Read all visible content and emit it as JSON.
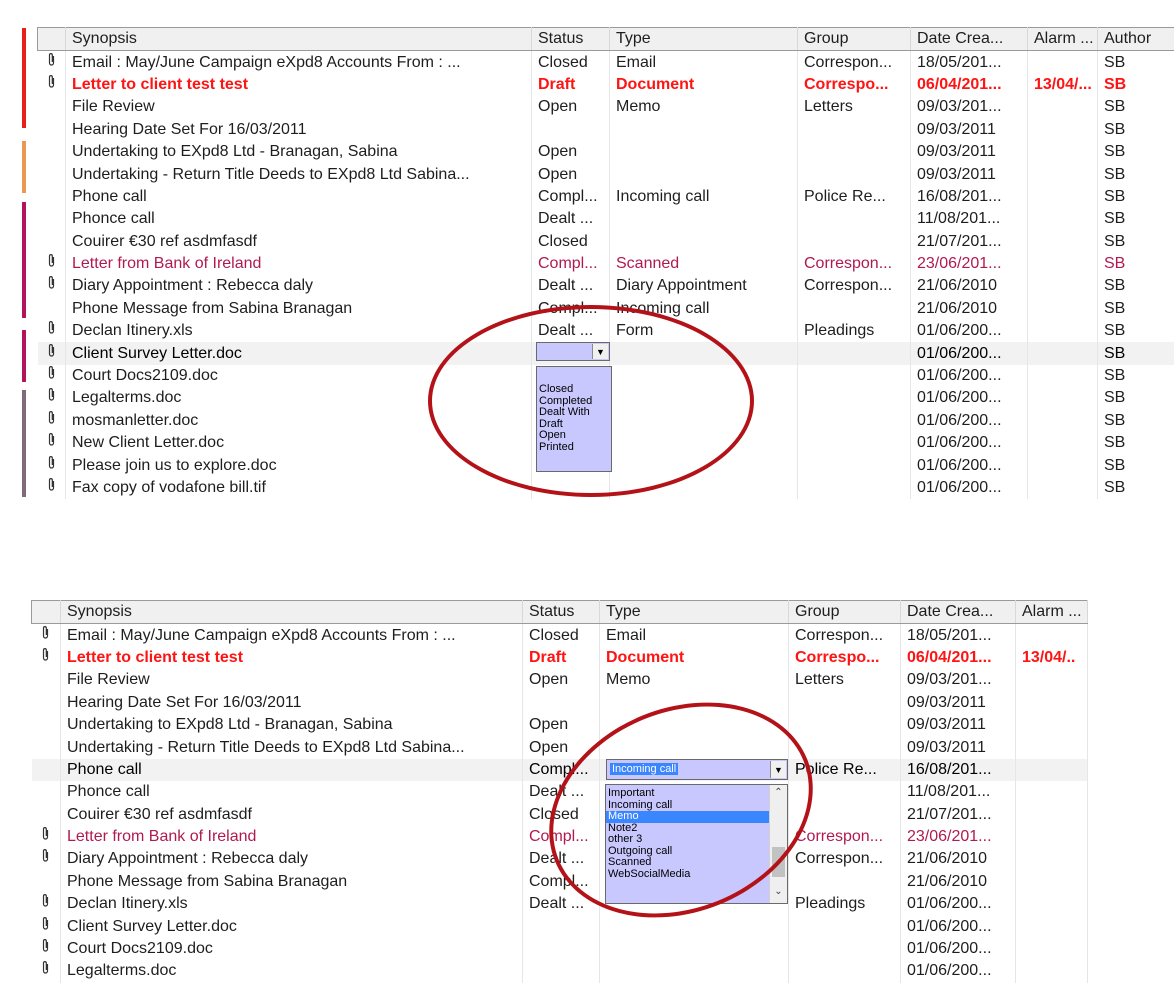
{
  "top_panel": {
    "columns": [
      "",
      "Synopsis",
      "Status",
      "Type",
      "Group",
      "Date Crea...",
      "Alarm ...",
      "Author"
    ],
    "rows": [
      {
        "clip": true,
        "style": "",
        "cells": [
          "Email : May/June Campaign eXpd8 Accounts From : ...",
          "Closed",
          "Email",
          "Correspon...",
          "18/05/201...",
          "",
          "SB"
        ]
      },
      {
        "clip": true,
        "style": "bold",
        "cells": [
          "Letter to client test test",
          "Draft",
          "Document",
          "Correspo...",
          "06/04/201...",
          "13/04/...",
          "SB"
        ]
      },
      {
        "clip": false,
        "style": "",
        "cells": [
          "File Review",
          "Open",
          "Memo",
          "Letters",
          "09/03/201...",
          "",
          "SB"
        ]
      },
      {
        "clip": false,
        "style": "",
        "cells": [
          "Hearing Date Set For 16/03/2011",
          "",
          "",
          "",
          "09/03/2011",
          "",
          "SB"
        ]
      },
      {
        "clip": false,
        "style": "",
        "cells": [
          "Undertaking to EXpd8 Ltd - Branagan, Sabina",
          "Open",
          "",
          "",
          "09/03/2011",
          "",
          "SB"
        ]
      },
      {
        "clip": false,
        "style": "",
        "cells": [
          "Undertaking - Return Title Deeds to EXpd8 Ltd Sabina...",
          "Open",
          "",
          "",
          "09/03/2011",
          "",
          "SB"
        ]
      },
      {
        "clip": false,
        "style": "",
        "cells": [
          "Phone call",
          "Compl...",
          "Incoming call",
          "Police Re...",
          "16/08/201...",
          "",
          "SB"
        ]
      },
      {
        "clip": false,
        "style": "",
        "cells": [
          "Phonce call",
          "Dealt ...",
          "",
          "",
          "11/08/201...",
          "",
          "SB"
        ]
      },
      {
        "clip": false,
        "style": "",
        "cells": [
          "Couirer €30 ref asdmfasdf",
          "Closed",
          "",
          "",
          "21/07/201...",
          "",
          "SB"
        ]
      },
      {
        "clip": true,
        "style": "maroon",
        "cells": [
          " Letter from Bank of Ireland",
          "Compl...",
          "Scanned",
          "Correspon...",
          "23/06/201...",
          "",
          "SB"
        ]
      },
      {
        "clip": true,
        "style": "",
        "cells": [
          "Diary Appointment : Rebecca daly",
          "Dealt ...",
          "Diary Appointment",
          "Correspon...",
          "21/06/2010",
          "",
          "SB"
        ]
      },
      {
        "clip": false,
        "style": "",
        "cells": [
          "Phone Message from Sabina Branagan",
          "Compl...",
          "Incoming call",
          "",
          "21/06/2010",
          "",
          "SB"
        ]
      },
      {
        "clip": true,
        "style": "",
        "cells": [
          "Declan Itinery.xls",
          "Dealt ...",
          "Form",
          "Pleadings",
          "01/06/200...",
          "",
          "SB"
        ]
      },
      {
        "clip": true,
        "style": "selected",
        "cells": [
          "Client Survey Letter.doc",
          "",
          "",
          "",
          "01/06/200...",
          "",
          "SB"
        ]
      },
      {
        "clip": true,
        "style": "",
        "cells": [
          "Court Docs2109.doc",
          "",
          "",
          "",
          "01/06/200...",
          "",
          "SB"
        ]
      },
      {
        "clip": true,
        "style": "",
        "cells": [
          "Legalterms.doc",
          "",
          "",
          "",
          "01/06/200...",
          "",
          "SB"
        ]
      },
      {
        "clip": true,
        "style": "",
        "cells": [
          "mosmanletter.doc",
          "",
          "",
          "",
          "01/06/200...",
          "",
          "SB"
        ]
      },
      {
        "clip": true,
        "style": "",
        "cells": [
          "New Client Letter.doc",
          "",
          "",
          "",
          "01/06/200...",
          "",
          "SB"
        ]
      },
      {
        "clip": true,
        "style": "",
        "cells": [
          "Please join us to explore.doc",
          "",
          "",
          "",
          "01/06/200...",
          "",
          "SB"
        ]
      },
      {
        "clip": true,
        "style": "",
        "cells": [
          "Fax copy of vodafone bill.tif",
          "",
          "",
          "",
          "01/06/200...",
          "",
          "SB"
        ]
      }
    ],
    "status_combo": {
      "value": ""
    },
    "status_options": [
      "Closed",
      "Completed",
      "Dealt With",
      "Draft",
      "Open",
      "Printed"
    ]
  },
  "bottom_panel": {
    "columns": [
      "",
      "Synopsis",
      "Status",
      "Type",
      "Group",
      "Date Crea...",
      "Alarm ..."
    ],
    "rows": [
      {
        "clip": true,
        "style": "",
        "cells": [
          "Email : May/June Campaign eXpd8 Accounts From : ...",
          "Closed",
          "Email",
          "Correspon...",
          "18/05/201...",
          ""
        ]
      },
      {
        "clip": true,
        "style": "bold",
        "cells": [
          "Letter to client test test",
          "Draft",
          "Document",
          "Correspo...",
          "06/04/201...",
          "13/04/.."
        ]
      },
      {
        "clip": false,
        "style": "",
        "cells": [
          "File Review",
          "Open",
          "Memo",
          "Letters",
          "09/03/201...",
          ""
        ]
      },
      {
        "clip": false,
        "style": "",
        "cells": [
          "Hearing Date Set For 16/03/2011",
          "",
          "",
          "",
          "09/03/2011",
          ""
        ]
      },
      {
        "clip": false,
        "style": "",
        "cells": [
          "Undertaking to EXpd8 Ltd - Branagan, Sabina",
          "Open",
          "",
          "",
          "09/03/2011",
          ""
        ]
      },
      {
        "clip": false,
        "style": "",
        "cells": [
          "Undertaking - Return Title Deeds to EXpd8 Ltd Sabina...",
          "Open",
          "",
          "",
          "09/03/2011",
          ""
        ]
      },
      {
        "clip": false,
        "style": "selected",
        "cells": [
          "Phone call",
          "Compl...",
          "",
          "Police Re...",
          "16/08/201...",
          ""
        ]
      },
      {
        "clip": false,
        "style": "",
        "cells": [
          "Phonce call",
          "Dealt ...",
          "",
          "",
          "11/08/201...",
          ""
        ]
      },
      {
        "clip": false,
        "style": "",
        "cells": [
          "Couirer €30 ref asdmfasdf",
          "Closed",
          "",
          "",
          "21/07/201...",
          ""
        ]
      },
      {
        "clip": true,
        "style": "maroon",
        "cells": [
          " Letter from Bank of Ireland",
          "Compl...",
          "",
          "Correspon...",
          "23/06/201...",
          ""
        ]
      },
      {
        "clip": true,
        "style": "",
        "cells": [
          "Diary Appointment : Rebecca daly",
          "Dealt ...",
          "",
          "Correspon...",
          "21/06/2010",
          ""
        ]
      },
      {
        "clip": false,
        "style": "",
        "cells": [
          "Phone Message from Sabina Branagan",
          "Compl...",
          "",
          "",
          "21/06/2010",
          ""
        ]
      },
      {
        "clip": true,
        "style": "",
        "cells": [
          "Declan Itinery.xls",
          "Dealt ...",
          "",
          "Pleadings",
          "01/06/200...",
          ""
        ]
      },
      {
        "clip": true,
        "style": "",
        "cells": [
          "Client Survey Letter.doc",
          "",
          "",
          "",
          "01/06/200...",
          ""
        ]
      },
      {
        "clip": true,
        "style": "",
        "cells": [
          "Court Docs2109.doc",
          "",
          "",
          "",
          "01/06/200...",
          ""
        ]
      },
      {
        "clip": true,
        "style": "",
        "cells": [
          "Legalterms.doc",
          "",
          "",
          "",
          "01/06/200...",
          ""
        ]
      }
    ],
    "type_combo": {
      "value": "Incoming call"
    },
    "type_options": [
      "Important",
      "Incoming call",
      "Memo",
      "Note2",
      "other 3",
      "Outgoing call",
      "Scanned",
      "WebSocialMedia"
    ],
    "type_selected_option": "Memo"
  },
  "icons": {
    "attachment": "paperclip-icon",
    "dropdown_arrow": "chevron-down-icon"
  },
  "colors": {
    "bold_row": "#ff1414",
    "maroon_row": "#b01a50",
    "dropdown_bg": "#c8c8ff",
    "dropdown_selected": "#3a86ff",
    "annotation_ellipse": "#b31218",
    "side_bars": [
      "#e8201c",
      "#e89a55",
      "#b0145a",
      "#b0145a",
      "#806a7a"
    ]
  }
}
